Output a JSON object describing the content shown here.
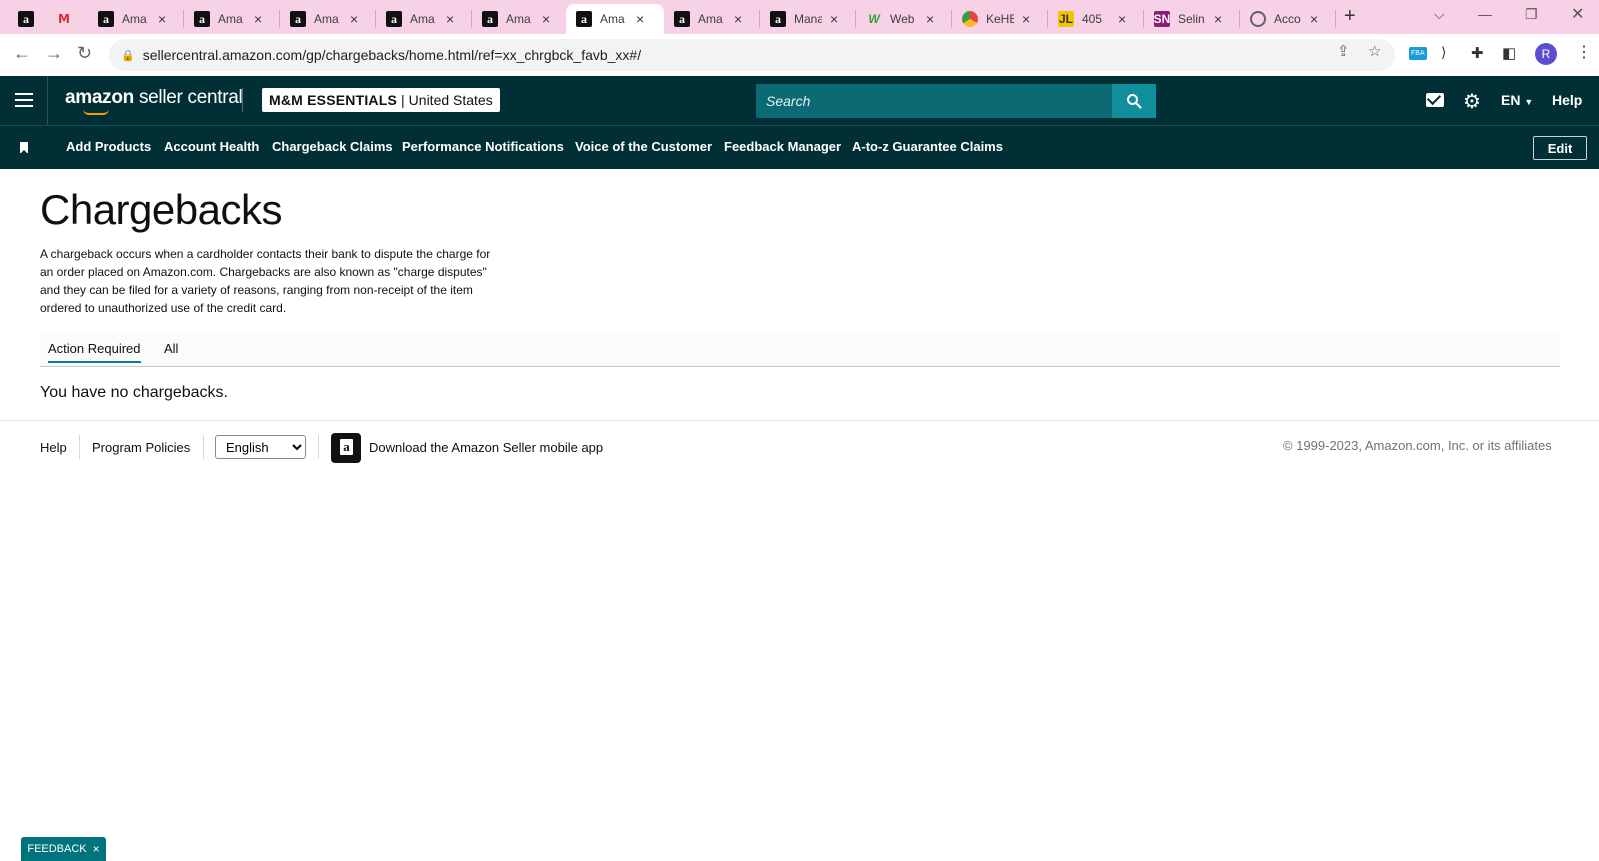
{
  "browser": {
    "tabs": [
      {
        "label": "",
        "icon": "amazon-icon"
      },
      {
        "label": "",
        "icon": "gmail-icon"
      },
      {
        "label": "Ama",
        "icon": "amazon-icon"
      },
      {
        "label": "Ama",
        "icon": "amazon-icon"
      },
      {
        "label": "Ama",
        "icon": "amazon-icon"
      },
      {
        "label": "Ama",
        "icon": "amazon-icon"
      },
      {
        "label": "Ama",
        "icon": "amazon-icon"
      },
      {
        "label": "Ama",
        "icon": "amazon-icon",
        "active": true
      },
      {
        "label": "Ama",
        "icon": "amazon-icon"
      },
      {
        "label": "Mana",
        "icon": "amazon-icon"
      },
      {
        "label": "Web",
        "icon": "web-icon"
      },
      {
        "label": "KeHE",
        "icon": "kehe-icon"
      },
      {
        "label": "405",
        "icon": "405-icon"
      },
      {
        "label": "Selin",
        "icon": "sn-icon"
      },
      {
        "label": "Acco",
        "icon": "globe-icon"
      }
    ],
    "url": "sellercentral.amazon.com/gp/chargebacks/home.html/ref=xx_chrgbck_favb_xx#/",
    "profile_initial": "R",
    "fba_badge": "FBA",
    "new_tab_glyph": "+",
    "tab_close_glyph": "×",
    "tab_frame_color": "#f7d2e6"
  },
  "header": {
    "logo_brand": "amazon",
    "logo_suffix": "seller central",
    "store_name": "M&M ESSENTIALS",
    "store_sep": "|",
    "marketplace": "United States",
    "search_placeholder": "Search",
    "language": "EN",
    "help": "Help",
    "bg_color": "#002f36",
    "search_color": "#0b6a74",
    "search_button_color": "#118e9b"
  },
  "bookmarks": {
    "items": [
      "Add Products",
      "Account Health",
      "Chargeback Claims",
      "Performance Notifications",
      "Voice of the Customer",
      "Feedback Manager",
      "A-to-z Guarantee Claims"
    ],
    "edit_label": "Edit"
  },
  "page": {
    "title": "Chargebacks",
    "description": "A chargeback occurs when a cardholder contacts their bank to dispute the charge for an order placed on Amazon.com. Chargebacks are also known as \"charge disputes\" and they can be filed for a variety of reasons, ranging from non-receipt of the item ordered to unauthorized use of the credit card.",
    "tabs": [
      "Action Required",
      "All"
    ],
    "active_tab": "Action Required",
    "empty_message": "You have no chargebacks.",
    "accent_color": "#008296"
  },
  "footer": {
    "help": "Help",
    "program_policies": "Program Policies",
    "language_selected": "English",
    "app_download": "Download the Amazon Seller mobile app",
    "copyright": "© 1999-2023, Amazon.com, Inc. or its affiliates"
  },
  "feedback": {
    "label": "FEEDBACK",
    "close": "×",
    "color": "#00747d"
  }
}
